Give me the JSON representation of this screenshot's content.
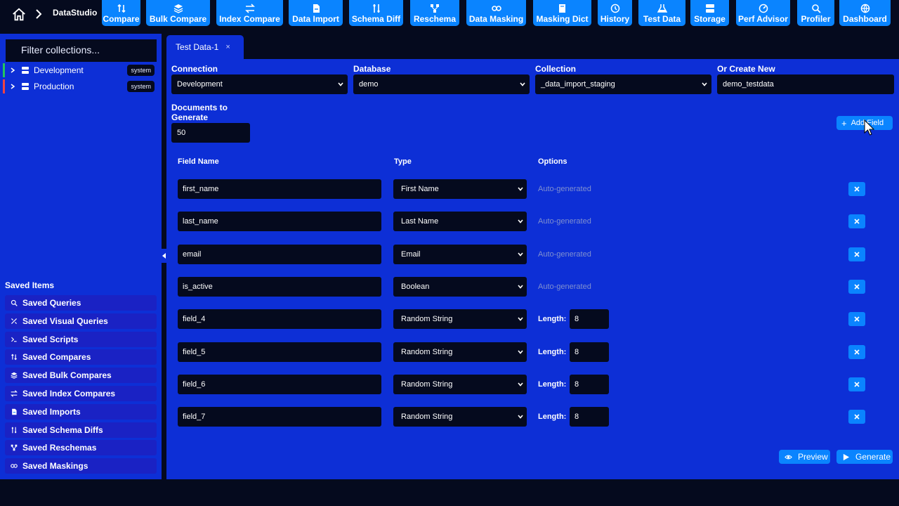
{
  "app": {
    "title": "DataStudio"
  },
  "toolbar": [
    {
      "label": "Compare",
      "icon": "compare-icon"
    },
    {
      "label": "Bulk Compare",
      "icon": "layers-icon"
    },
    {
      "label": "Index Compare",
      "icon": "swap-icon"
    },
    {
      "label": "Data Import",
      "icon": "file-import-icon"
    },
    {
      "label": "Schema Diff",
      "icon": "diff-icon"
    },
    {
      "label": "Reschema",
      "icon": "network-icon"
    },
    {
      "label": "Data Masking",
      "icon": "mask-icon"
    },
    {
      "label": "Masking Dict",
      "icon": "book-icon"
    },
    {
      "label": "History",
      "icon": "history-icon"
    },
    {
      "label": "Test Data",
      "icon": "flask-icon"
    },
    {
      "label": "Storage",
      "icon": "storage-icon"
    },
    {
      "label": "Perf Advisor",
      "icon": "gauge-icon"
    },
    {
      "label": "Profiler",
      "icon": "search-icon"
    },
    {
      "label": "Dashboard",
      "icon": "globe-icon"
    }
  ],
  "sidebar": {
    "filter_placeholder": "Filter collections...",
    "connections": [
      {
        "name": "Development",
        "badge": "system",
        "color": "#22c55e"
      },
      {
        "name": "Production",
        "badge": "system",
        "color": "#ef4444"
      }
    ],
    "saved_title": "Saved Items",
    "saved": [
      {
        "label": "Saved Queries",
        "icon": "search-icon"
      },
      {
        "label": "Saved Visual Queries",
        "icon": "visual-query-icon"
      },
      {
        "label": "Saved Scripts",
        "icon": "terminal-icon"
      },
      {
        "label": "Saved Compares",
        "icon": "compare-icon"
      },
      {
        "label": "Saved Bulk Compares",
        "icon": "layers-icon"
      },
      {
        "label": "Saved Index Compares",
        "icon": "swap-icon"
      },
      {
        "label": "Saved Imports",
        "icon": "file-import-icon"
      },
      {
        "label": "Saved Schema Diffs",
        "icon": "diff-icon"
      },
      {
        "label": "Saved Reschemas",
        "icon": "network-icon"
      },
      {
        "label": "Saved Maskings",
        "icon": "mask-icon"
      }
    ]
  },
  "tab": {
    "label": "Test Data-1",
    "close": "×"
  },
  "form": {
    "connection_label": "Connection",
    "connection_value": "Development",
    "database_label": "Database",
    "database_value": "demo",
    "collection_label": "Collection",
    "collection_value": "_data_import_staging",
    "create_label": "Or Create New",
    "create_value": "demo_testdata",
    "docs_label_1": "Documents to",
    "docs_label_2": "Generate",
    "docs_value": "50",
    "add_field_label": "Add Field"
  },
  "fields_header": {
    "name": "Field Name",
    "type": "Type",
    "options": "Options"
  },
  "fields": [
    {
      "name": "first_name",
      "type": "First Name",
      "options": "Auto-generated"
    },
    {
      "name": "last_name",
      "type": "Last Name",
      "options": "Auto-generated"
    },
    {
      "name": "email",
      "type": "Email",
      "options": "Auto-generated"
    },
    {
      "name": "is_active",
      "type": "Boolean",
      "options": "Auto-generated"
    },
    {
      "name": "field_4",
      "type": "Random String",
      "length_label": "Length:",
      "length": "8"
    },
    {
      "name": "field_5",
      "type": "Random String",
      "length_label": "Length:",
      "length": "8"
    },
    {
      "name": "field_6",
      "type": "Random String",
      "length_label": "Length:",
      "length": "8"
    },
    {
      "name": "field_7",
      "type": "Random String",
      "length_label": "Length:",
      "length": "8"
    }
  ],
  "actions": {
    "preview": "Preview",
    "generate": "Generate"
  },
  "colors": {
    "accent": "#0a84ff",
    "panel": "#0d2fd6",
    "dark": "#050a1e"
  }
}
